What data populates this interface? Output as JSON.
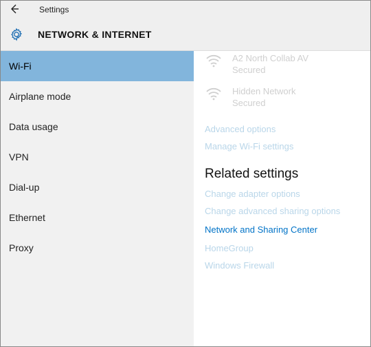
{
  "header": {
    "app_title": "Settings",
    "section_title": "NETWORK & INTERNET"
  },
  "sidebar": {
    "items": [
      {
        "label": "Wi-Fi",
        "selected": true
      },
      {
        "label": "Airplane mode",
        "selected": false
      },
      {
        "label": "Data usage",
        "selected": false
      },
      {
        "label": "VPN",
        "selected": false
      },
      {
        "label": "Dial-up",
        "selected": false
      },
      {
        "label": "Ethernet",
        "selected": false
      },
      {
        "label": "Proxy",
        "selected": false
      }
    ]
  },
  "content": {
    "networks": [
      {
        "name": "A2 North Collab AV",
        "status": "Secured"
      },
      {
        "name": "Hidden Network",
        "status": "Secured"
      }
    ],
    "links_top": [
      "Advanced options",
      "Manage Wi-Fi settings"
    ],
    "related_heading": "Related settings",
    "related_links": [
      {
        "label": "Change adapter options",
        "active": false
      },
      {
        "label": "Change advanced sharing options",
        "active": false
      },
      {
        "label": "Network and Sharing Center",
        "active": true
      },
      {
        "label": "HomeGroup",
        "active": false
      },
      {
        "label": "Windows Firewall",
        "active": false
      }
    ]
  },
  "colors": {
    "accent": "#0173c7",
    "selection": "#82b5dc",
    "faded_link": "#b9d6e9",
    "disabled_text": "#cfcfcf",
    "sidebar_bg": "#f1f1f1",
    "header_bg": "#efefef"
  },
  "icons": {
    "back": "back-arrow-icon",
    "gear": "gear-icon",
    "wifi": "wifi-signal-icon"
  }
}
